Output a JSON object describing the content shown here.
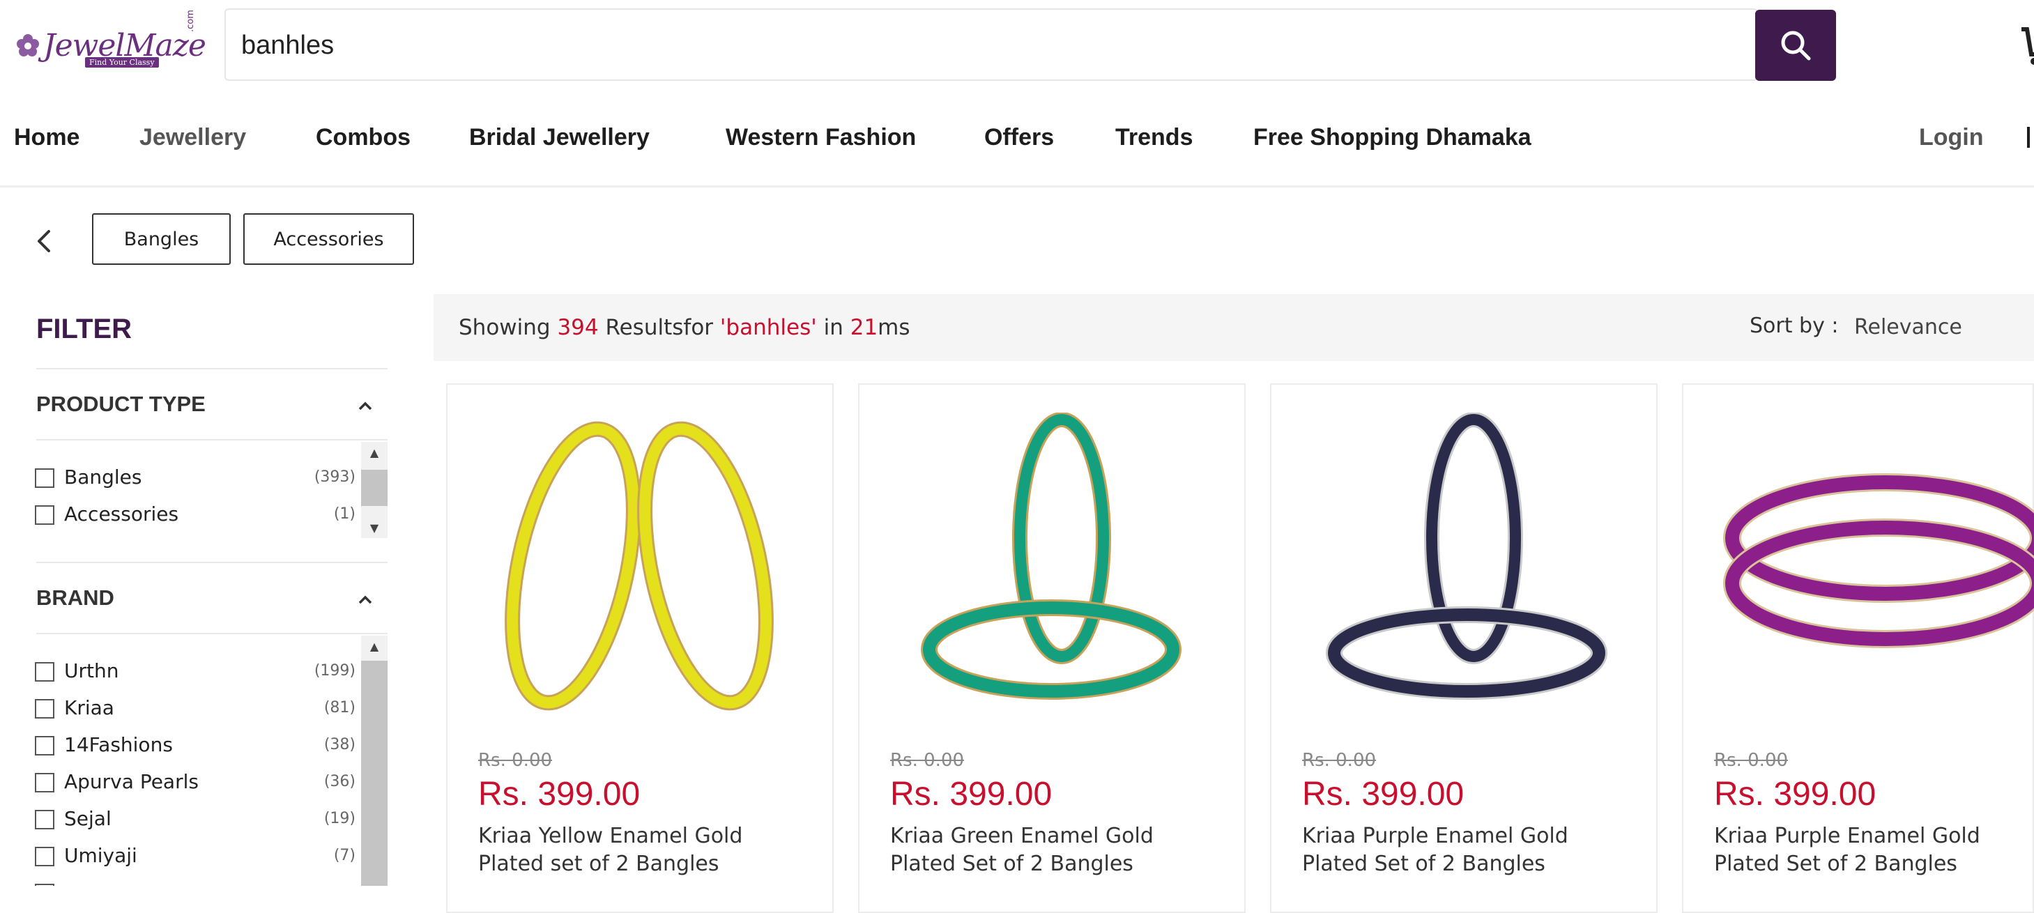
{
  "header": {
    "logo": {
      "wordmark": "JewelMaze",
      "tagline": "Find Your Classy",
      "domain_suffix": ".com",
      "brand_color": "#6b2f80"
    },
    "search": {
      "value": "banhles",
      "placeholder": "",
      "button_icon": "search-icon",
      "button_color": "#3f1a4d"
    },
    "cart_icon": "cart-icon"
  },
  "nav": {
    "items": [
      {
        "label": "Home"
      },
      {
        "label": "Jewellery"
      },
      {
        "label": "Combos"
      },
      {
        "label": "Bridal Jewellery"
      },
      {
        "label": "Western Fashion"
      },
      {
        "label": "Offers"
      },
      {
        "label": "Trends"
      },
      {
        "label": "Free Shopping Dhamaka"
      }
    ],
    "login": "Login"
  },
  "chips": {
    "back_icon": "chevron-left-icon",
    "items": [
      {
        "label": "Bangles"
      },
      {
        "label": "Accessories"
      }
    ]
  },
  "filter": {
    "title": "FILTER",
    "sections": [
      {
        "title": "PRODUCT TYPE",
        "options": [
          {
            "label": "Bangles",
            "count": "(393)"
          },
          {
            "label": "Accessories",
            "count": "(1)"
          }
        ]
      },
      {
        "title": "BRAND",
        "options": [
          {
            "label": "Urthn",
            "count": "(199)"
          },
          {
            "label": "Kriaa",
            "count": "(81)"
          },
          {
            "label": "14Fashions",
            "count": "(38)"
          },
          {
            "label": "Apurva Pearls",
            "count": "(36)"
          },
          {
            "label": "Sejal",
            "count": "(19)"
          },
          {
            "label": "Umiyaji",
            "count": "(7)"
          }
        ]
      }
    ]
  },
  "results": {
    "prefix": "Showing ",
    "count": "394",
    "middle": " Resultsfor ",
    "query": "'banhles'",
    "in_text": " in ",
    "time": "21",
    "unit": "ms",
    "highlight_color": "#c8102e"
  },
  "sort": {
    "label": "Sort by :",
    "value": "Relevance"
  },
  "products": [
    {
      "mrp": "Rs. 0.00",
      "price": "Rs. 399.00",
      "name": "Kriaa Yellow Enamel Gold Plated set of 2 Bangles",
      "color": "#e4e01c"
    },
    {
      "mrp": "Rs. 0.00",
      "price": "Rs. 399.00",
      "name": "Kriaa Green Enamel Gold Plated Set of 2 Bangles",
      "color": "#14a07e"
    },
    {
      "mrp": "Rs. 0.00",
      "price": "Rs. 399.00",
      "name": "Kriaa Purple Enamel Gold Plated Set of 2 Bangles",
      "color": "#2a2a4a"
    },
    {
      "mrp": "Rs. 0.00",
      "price": "Rs. 399.00",
      "name": "Kriaa Purple Enamel Gold Plated Set of 2 Bangles",
      "color": "#8c1f8a"
    }
  ]
}
